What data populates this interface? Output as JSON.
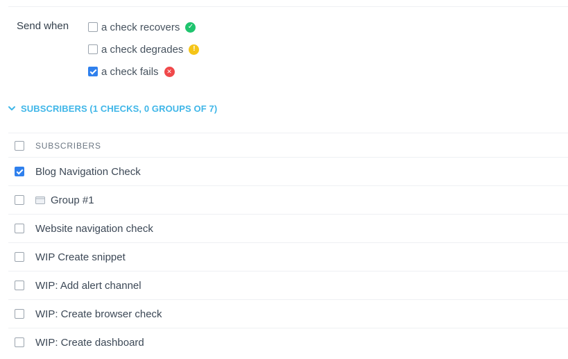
{
  "send_when": {
    "label": "Send when",
    "options": [
      {
        "label": "a check recovers",
        "checked": false,
        "icon": "check-circle-icon",
        "color": "#1fc46e",
        "glyph": "✓"
      },
      {
        "label": "a check degrades",
        "checked": false,
        "icon": "warning-circle-icon",
        "color": "#f5c518",
        "glyph": "!"
      },
      {
        "label": "a check fails",
        "checked": true,
        "icon": "error-circle-icon",
        "color": "#f0484a",
        "glyph": "✕"
      }
    ]
  },
  "subscribers": {
    "toggle_label": "SUBSCRIBERS (1 CHECKS, 0 GROUPS OF 7)",
    "accent_color": "#3fb6e8",
    "header": "SUBSCRIBERS",
    "rows": [
      {
        "label": "Blog Navigation Check",
        "checked": true,
        "icon": null
      },
      {
        "label": "Group #1",
        "checked": false,
        "icon": "folder-icon"
      },
      {
        "label": "Website navigation check",
        "checked": false,
        "icon": null
      },
      {
        "label": "WIP Create snippet",
        "checked": false,
        "icon": null
      },
      {
        "label": "WIP: Add alert channel",
        "checked": false,
        "icon": null
      },
      {
        "label": "WIP: Create browser check",
        "checked": false,
        "icon": null
      },
      {
        "label": "WIP: Create dashboard",
        "checked": false,
        "icon": null
      }
    ]
  }
}
